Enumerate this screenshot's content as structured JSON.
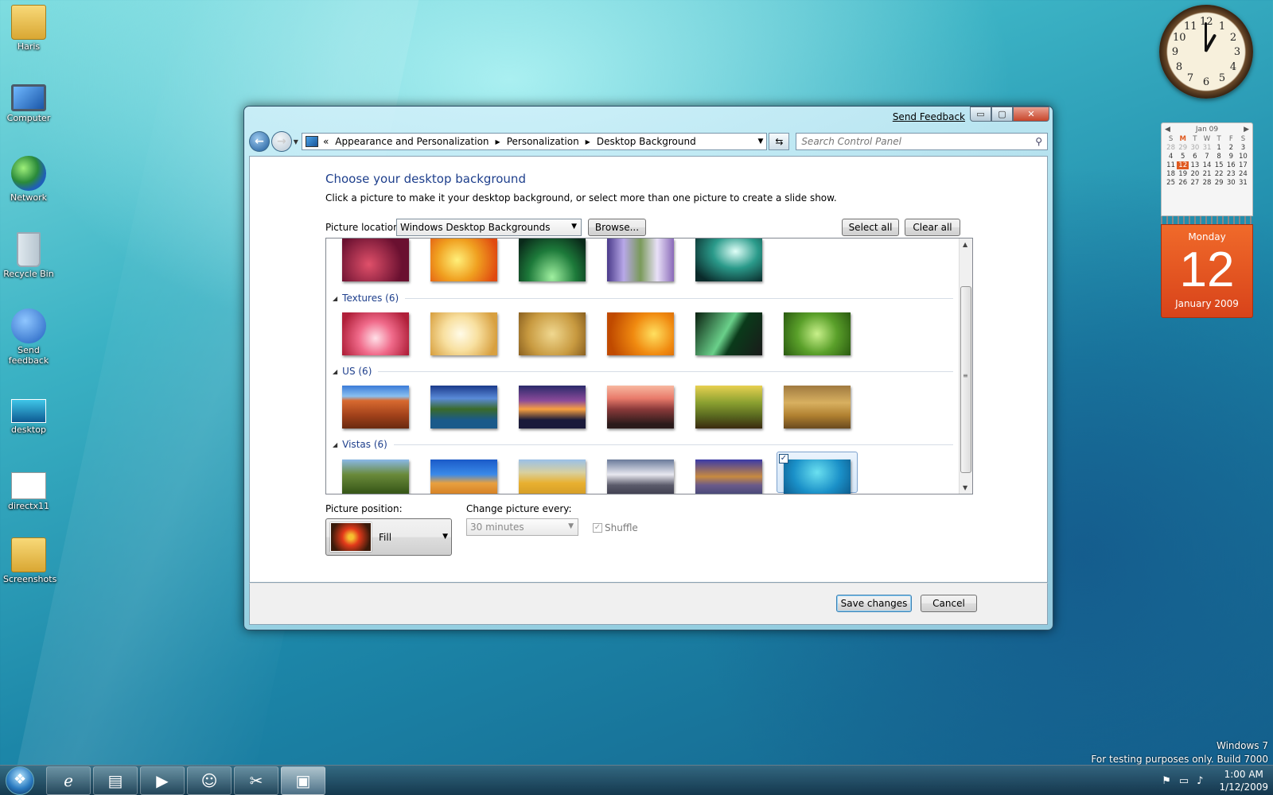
{
  "desktop": {
    "icons": [
      {
        "label": "Haris"
      },
      {
        "label": "Computer"
      },
      {
        "label": "Network"
      },
      {
        "label": "Recycle Bin"
      },
      {
        "label": "Send feedback"
      },
      {
        "label": "desktop"
      },
      {
        "label": "directx11"
      },
      {
        "label": "Screenshots"
      }
    ]
  },
  "clock": {
    "numbers": [
      "12",
      "1",
      "2",
      "3",
      "4",
      "5",
      "6",
      "7",
      "8",
      "9",
      "10",
      "11"
    ],
    "hour": 1,
    "minute": 0
  },
  "calendar": {
    "month_label": "Jan 09",
    "prev": "◀",
    "next": "▶",
    "weekdays": [
      "S",
      "M",
      "T",
      "W",
      "T",
      "F",
      "S"
    ],
    "days": [
      [
        "28",
        "29",
        "30",
        "31",
        "1",
        "2",
        "3"
      ],
      [
        "4",
        "5",
        "6",
        "7",
        "8",
        "9",
        "10"
      ],
      [
        "11",
        "12",
        "13",
        "14",
        "15",
        "16",
        "17"
      ],
      [
        "18",
        "19",
        "20",
        "21",
        "22",
        "23",
        "24"
      ],
      [
        "25",
        "26",
        "27",
        "28",
        "29",
        "30",
        "31"
      ]
    ],
    "day_of_week": "Monday",
    "day_number": "12",
    "month_year": "January 2009"
  },
  "window": {
    "send_feedback": "Send Feedback",
    "min_label": "▭",
    "max_label": "▢",
    "close_label": "✕",
    "breadcrumb": {
      "prefix": "«",
      "items": [
        "Appearance and Personalization",
        "Personalization",
        "Desktop Background"
      ]
    },
    "search_placeholder": "Search Control Panel",
    "heading": "Choose your desktop background",
    "description": "Click a picture to make it your desktop background, or select more than one picture to create a slide show.",
    "picture_location_label": "Picture location:",
    "picture_location_value": "Windows Desktop Backgrounds",
    "browse_label": "Browse...",
    "select_all_label": "Select all",
    "clear_all_label": "Clear all",
    "groups": [
      {
        "label": "Textures (6)"
      },
      {
        "label": "US (6)"
      },
      {
        "label": "Vistas (6)"
      }
    ],
    "picture_position_label": "Picture position:",
    "picture_position_value": "Fill",
    "change_every_label": "Change picture every:",
    "change_every_value": "30 minutes",
    "shuffle_label": "Shuffle",
    "save_label": "Save changes",
    "cancel_label": "Cancel"
  },
  "watermark": {
    "line1": "Windows 7",
    "line2": "For testing purposes only. Build 7000"
  },
  "tray": {
    "time": "1:00 AM",
    "date": "1/12/2009"
  },
  "colors": {
    "accent_heading": "#1e3f8c",
    "calendar_orange": "#e05a20"
  }
}
